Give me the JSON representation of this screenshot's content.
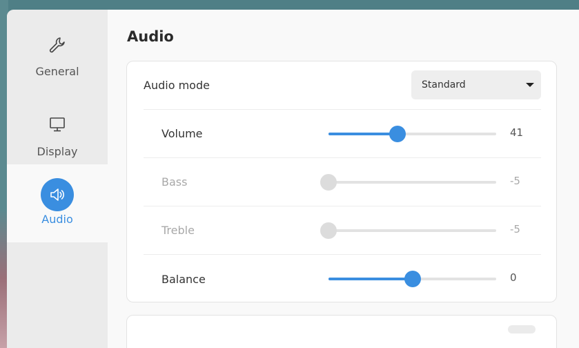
{
  "sidebar": {
    "items": [
      {
        "label": "General",
        "icon": "wrench-icon",
        "active": false
      },
      {
        "label": "Display",
        "icon": "monitor-icon",
        "active": false
      },
      {
        "label": "Audio",
        "icon": "speaker-icon",
        "active": true
      }
    ]
  },
  "page": {
    "title": "Audio"
  },
  "audio_mode": {
    "label": "Audio mode",
    "value": "Standard"
  },
  "sliders": [
    {
      "label": "Volume",
      "value": "41",
      "fraction": 0.41,
      "enabled": true
    },
    {
      "label": "Bass",
      "value": "-5",
      "fraction": 0.0,
      "enabled": false
    },
    {
      "label": "Treble",
      "value": "-5",
      "fraction": 0.0,
      "enabled": false
    },
    {
      "label": "Balance",
      "value": "0",
      "fraction": 0.5,
      "enabled": true
    }
  ],
  "colors": {
    "accent": "#3a8ee0",
    "disabled_text": "#a8a8a8"
  }
}
